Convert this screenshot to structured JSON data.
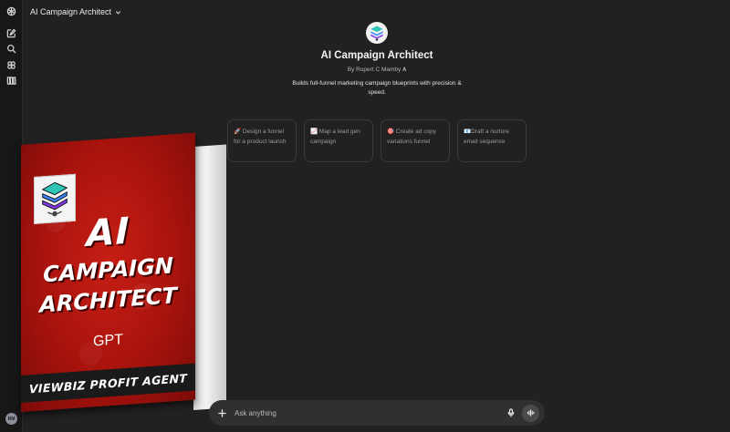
{
  "header": {
    "model_name": "AI Campaign Architect"
  },
  "gpt": {
    "title": "AI Campaign Architect",
    "author": "By Rupert C Mamby",
    "description": "Builds full-funnel marketing campaign blueprints with precision & speed."
  },
  "starters": [
    "🚀 Design a funnel for a product launch",
    "📈 Map a lead gen campaign",
    "🎯 Create ad copy variations funnel",
    "📧Draft a nurture email sequence"
  ],
  "product_box": {
    "line1": "AI",
    "line2": "CAMPAIGN",
    "line3": "ARCHITECT",
    "line4": "GPT",
    "band": "VIEWBIZ PROFIT AGENT"
  },
  "composer": {
    "placeholder": "Ask anything"
  },
  "user": {
    "avatar_initials": "RM"
  },
  "colors": {
    "background": "#212121",
    "sidebar": "#171717",
    "box_red": "#b3150e"
  }
}
